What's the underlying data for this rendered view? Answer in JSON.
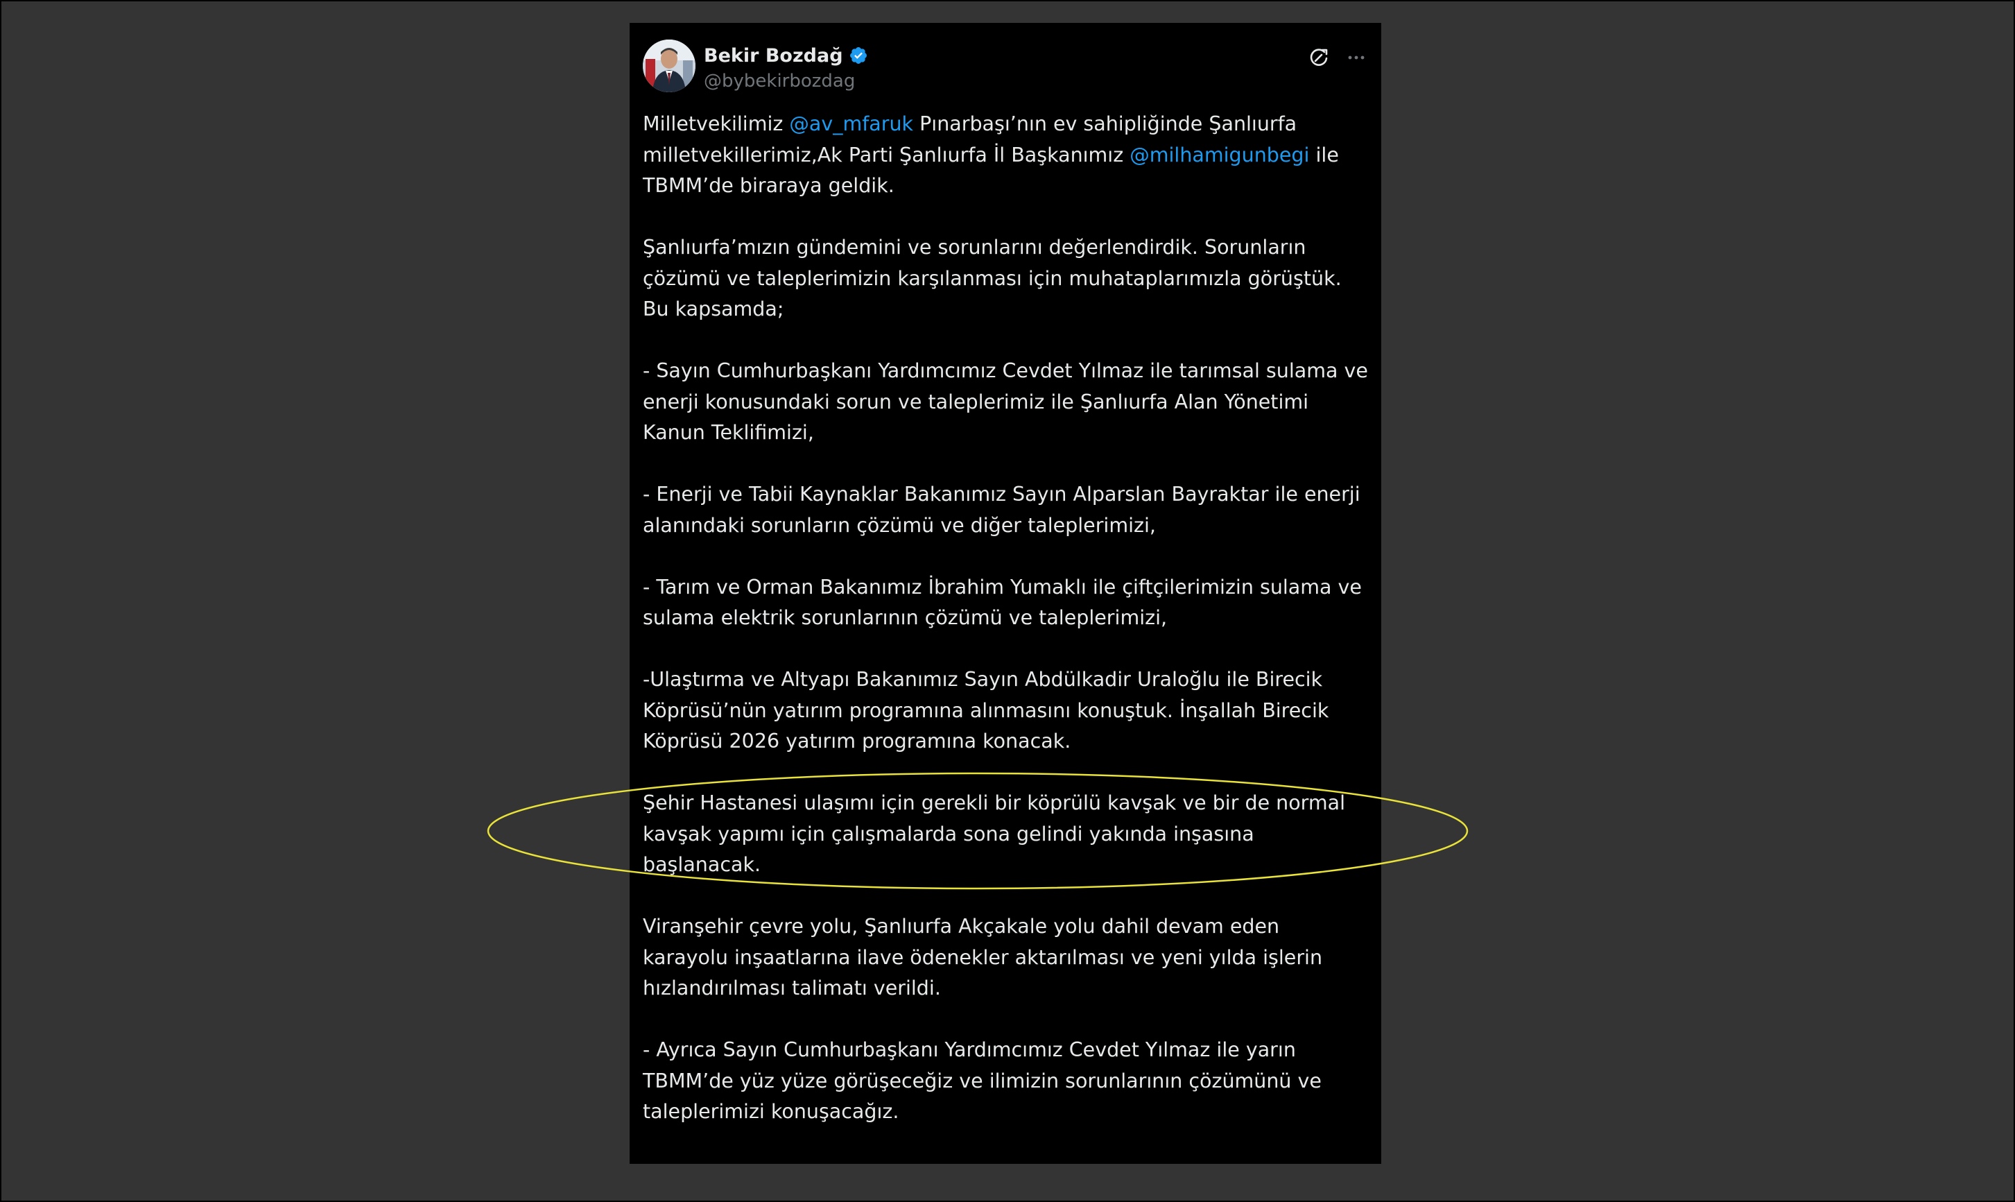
{
  "author": {
    "name": "Bekir Bozdağ",
    "handle": "@bybekirbozdag",
    "verified": true
  },
  "icons": {
    "verified": "verified-badge-icon",
    "grok": "grok-icon",
    "more": "more-icon"
  },
  "colors": {
    "background": "#343434",
    "card": "#000000",
    "text": "#e7e9ea",
    "handle": "#71767b",
    "mention": "#1d9bf0",
    "verified": "#1d9bf0",
    "highlight_ellipse": "#e8e23a"
  },
  "tweet": {
    "p1": {
      "t1": "Milletvekilimiz ",
      "m1": "@av_mfaruk",
      "t2": " Pınarbaşı’nın ev sahipliğinde Şanlıurfa milletvekillerimiz,Ak Parti Şanlıurfa İl Başkanımız ",
      "m2": "@milhamigunbegi",
      "t3": "  ile TBMM’de biraraya geldik."
    },
    "p2": "Şanlıurfa’mızın gündemini ve sorunlarını değerlendirdik. Sorunların çözümü ve taleplerimizin karşılanması için muhataplarımızla görüştük. Bu kapsamda;",
    "p3": "- Sayın Cumhurbaşkanı Yardımcımız Cevdet Yılmaz ile tarımsal sulama ve enerji konusundaki sorun ve taleplerimiz ile Şanlıurfa Alan Yönetimi Kanun Teklifimizi,",
    "p4": "- Enerji ve Tabii Kaynaklar Bakanımız Sayın Alparslan Bayraktar ile enerji alanındaki sorunların çözümü ve diğer taleplerimizi,",
    "p5": "- Tarım ve Orman Bakanımız İbrahim Yumaklı ile çiftçilerimizin sulama ve sulama elektrik sorunlarının çözümü ve taleplerimizi,",
    "p6": "-Ulaştırma ve Altyapı Bakanımız Sayın Abdülkadir Uraloğlu ile Birecik Köprüsü’nün yatırım programına alınmasını konuştuk. İnşallah Birecik Köprüsü 2026 yatırım programına konacak.",
    "p7": "Şehir Hastanesi ulaşımı için gerekli bir köprülü kavşak ve bir de normal kavşak yapımı için çalışmalarda sona gelindi yakında inşasına başlanacak.",
    "p8": "Viranşehir çevre yolu, Şanlıurfa Akçakale yolu dahil devam eden karayolu inşaatlarına ilave ödenekler aktarılması ve yeni yılda işlerin hızlandırılması talimatı verildi.",
    "p9": "- Ayrıca Sayın Cumhurbaşkanı Yardımcımız Cevdet Yılmaz ile yarın TBMM’de yüz yüze görüşeceğiz ve ilimizin sorunlarının çözümünü ve taleplerimizi konuşacağız."
  }
}
